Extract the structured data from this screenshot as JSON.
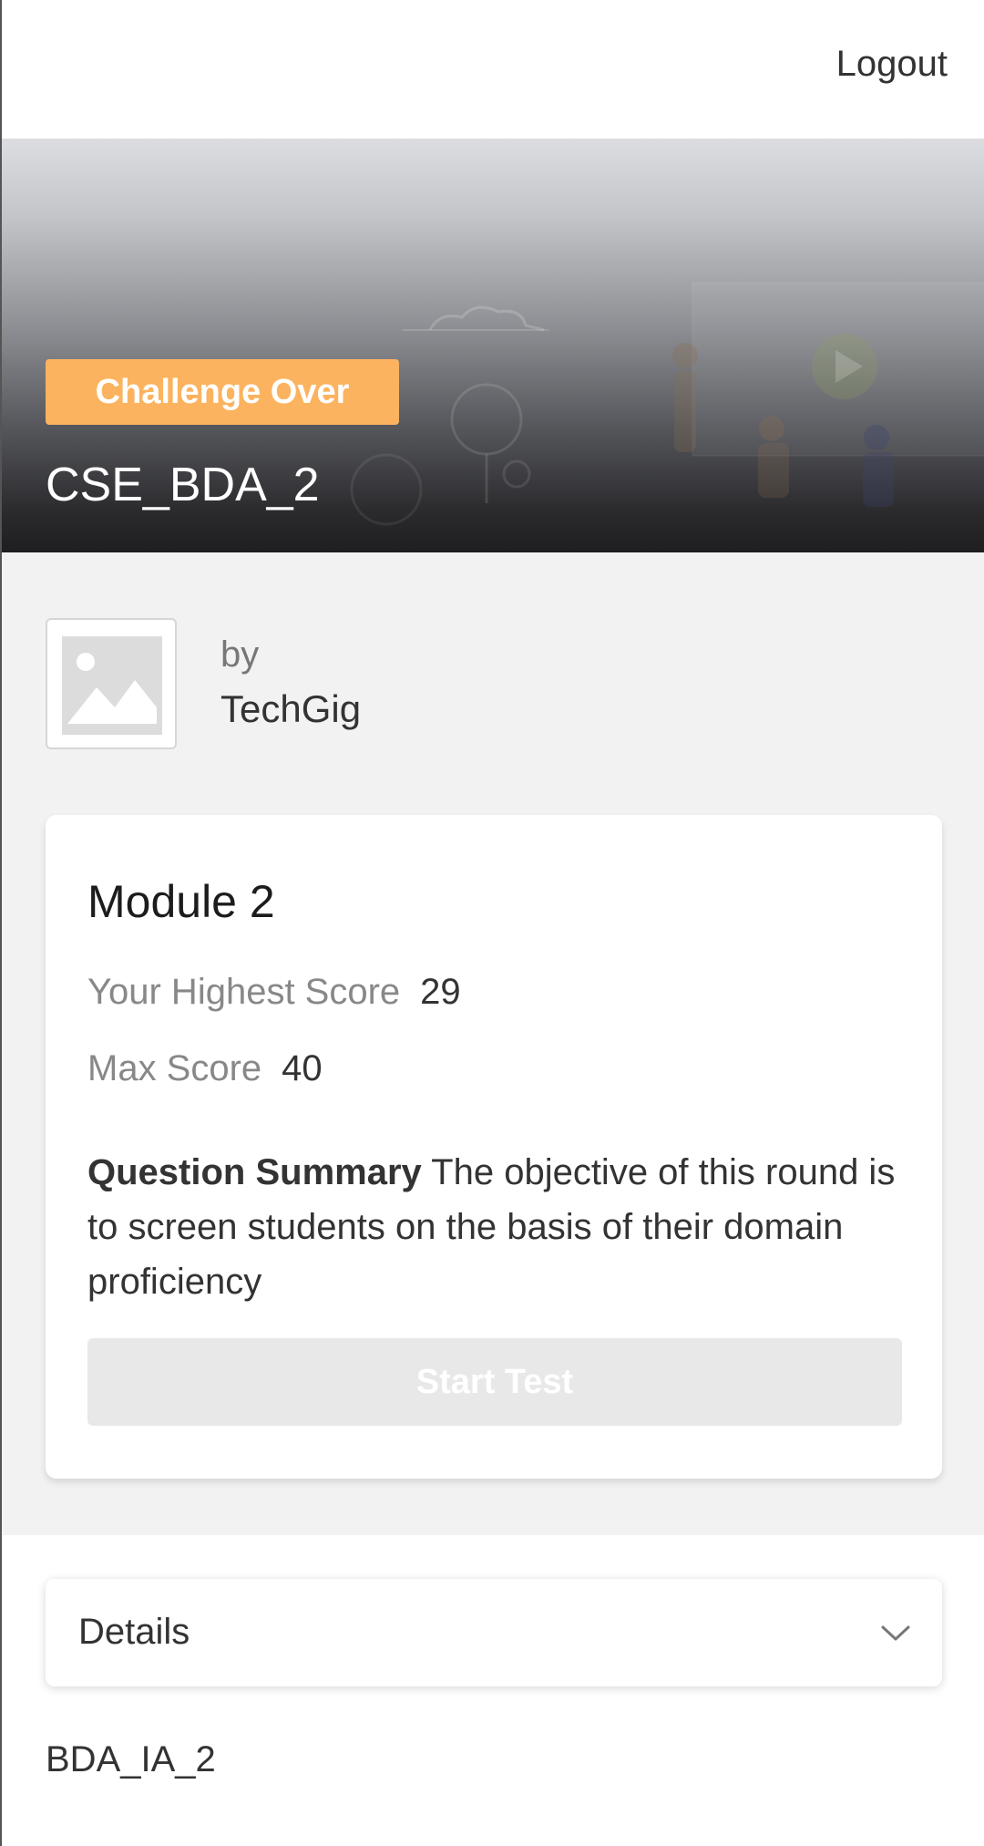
{
  "header": {
    "logout_label": "Logout"
  },
  "hero": {
    "badge": "Challenge Over",
    "title": "CSE_BDA_2"
  },
  "organizer": {
    "by_label": "by",
    "name": "TechGig",
    "logo_icon": "image-placeholder-icon"
  },
  "module": {
    "title": "Module 2",
    "highest_score_label": "Your Highest Score",
    "highest_score_value": "29",
    "max_score_label": "Max Score",
    "max_score_value": "40",
    "summary_label": "Question Summary",
    "summary_text": "The objective of this round is to screen students on the basis of their domain proficiency",
    "start_button_label": "Start Test"
  },
  "details": {
    "label": "Details",
    "toggle_icon": "chevron-down-icon",
    "content": "BDA_IA_2"
  },
  "colors": {
    "badge": "#fbb35f",
    "page_bg": "#f2f2f2",
    "disabled_button": "#e8e8e8"
  }
}
